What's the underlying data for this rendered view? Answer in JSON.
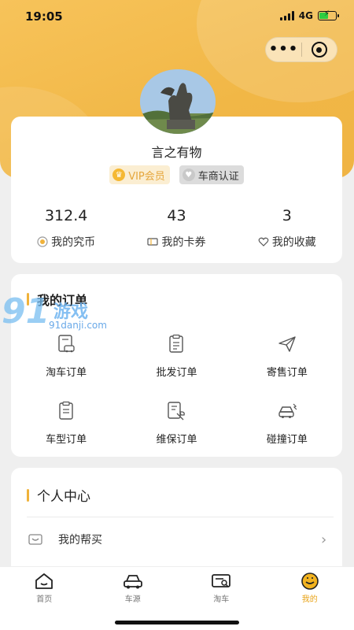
{
  "status_bar": {
    "time": "19:05",
    "network": "4G"
  },
  "capsule": {
    "more_label": "•••"
  },
  "profile": {
    "username": "言之有物",
    "badges": [
      {
        "label": "VIP会员",
        "icon": "crown-icon"
      },
      {
        "label": "车商认证",
        "icon": "heart-badge-icon"
      }
    ],
    "stats": [
      {
        "value": "312.4",
        "label": "我的究币",
        "icon": "coin-icon"
      },
      {
        "value": "43",
        "label": "我的卡券",
        "icon": "ticket-icon"
      },
      {
        "value": "3",
        "label": "我的收藏",
        "icon": "heart-icon"
      }
    ]
  },
  "orders": {
    "title": "我的订单",
    "items": [
      {
        "label": "淘车订单",
        "icon": "car-document-icon"
      },
      {
        "label": "批发订单",
        "icon": "checklist-icon"
      },
      {
        "label": "寄售订单",
        "icon": "send-icon"
      },
      {
        "label": "车型订单",
        "icon": "clipboard-icon"
      },
      {
        "label": "维保订单",
        "icon": "wrench-document-icon"
      },
      {
        "label": "碰撞订单",
        "icon": "crash-car-icon"
      }
    ]
  },
  "watermark": {
    "number": "91",
    "text": "游戏",
    "url": "91danji.com"
  },
  "personal_center": {
    "title": "个人中心",
    "menu": [
      {
        "label": "我的帮买",
        "icon": "basket-icon"
      }
    ]
  },
  "tabbar": {
    "tabs": [
      {
        "label": "首页",
        "icon": "home-icon",
        "active": false
      },
      {
        "label": "车源",
        "icon": "car-icon",
        "active": false
      },
      {
        "label": "淘车",
        "icon": "search-car-icon",
        "active": false
      },
      {
        "label": "我的",
        "icon": "face-icon",
        "active": true
      }
    ]
  },
  "colors": {
    "accent": "#f0b23a",
    "active_tab": "#e8a317"
  }
}
